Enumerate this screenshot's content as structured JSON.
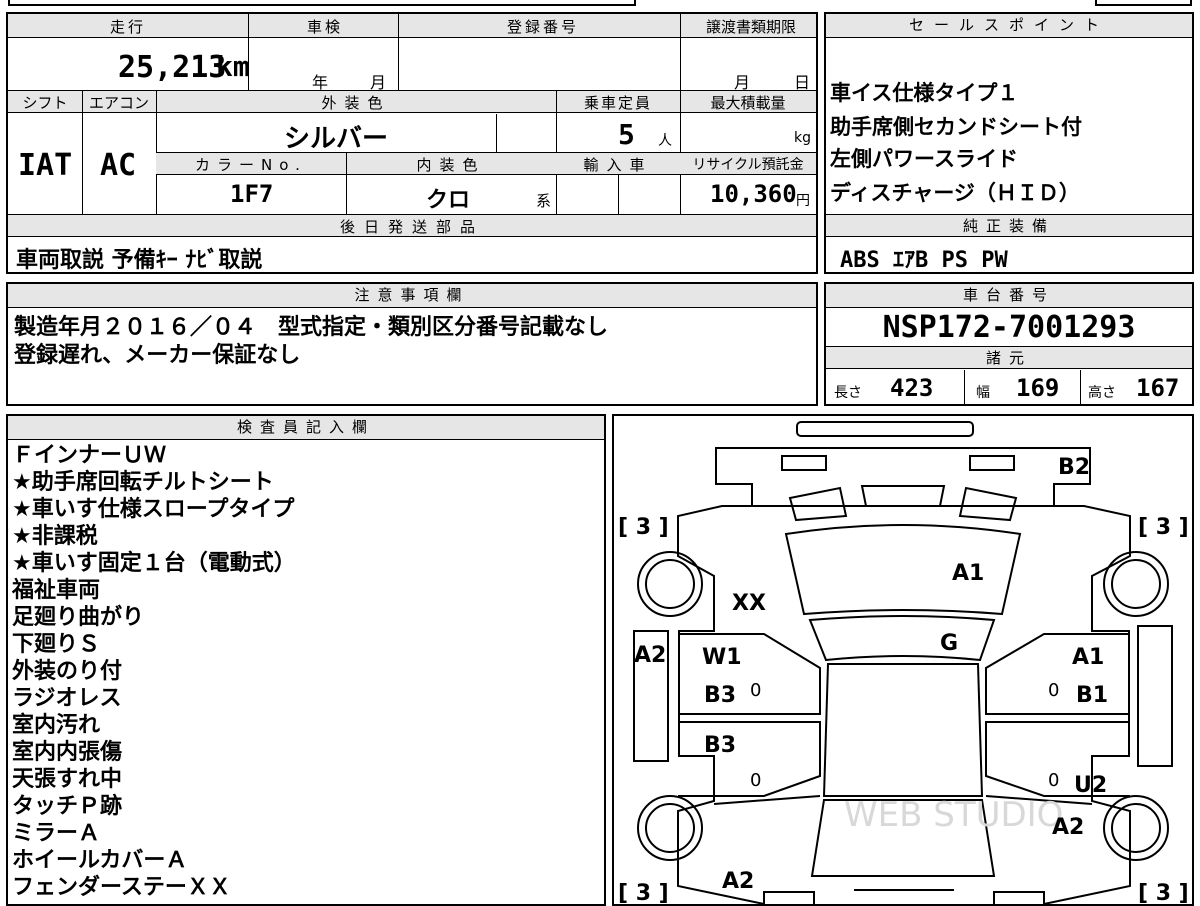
{
  "top_info": {
    "mileage_label": "走行",
    "mileage_value": "25,213",
    "mileage_unit": "km",
    "inspection_label": "車検",
    "inspection_year_unit": "年",
    "inspection_month_unit": "月",
    "registration_label": "登録番号",
    "transfer_deadline_label": "譲渡書類期限",
    "transfer_month_unit": "月",
    "transfer_day_unit": "日",
    "shift_label": "シフト",
    "shift_value": "IAT",
    "ac_label": "エアコン",
    "ac_value": "AC",
    "exterior_color_label": "外装色",
    "exterior_color_value": "シルバー",
    "capacity_label": "乗車定員",
    "capacity_value": "5",
    "capacity_unit": "人",
    "max_load_label": "最大積載量",
    "max_load_unit": "kg",
    "color_no_label": "カラーNo.",
    "color_no_value": "1F7",
    "interior_color_label": "内装色",
    "interior_color_value": "クロ",
    "interior_color_suffix": "系",
    "import_label": "輸入車",
    "recycle_label": "リサイクル預託金",
    "recycle_value": "10,360",
    "recycle_unit": "円",
    "later_parts_label": "後日発送部品",
    "later_parts_value": "車両取説 予備ｷｰ ﾅﾋﾞ取説"
  },
  "sales_points": {
    "label": "セールスポイント",
    "items": [
      "車イス仕様タイプ１",
      "助手席側セカンドシート付",
      "左側パワースライド",
      "ディスチャージ（ＨＩＤ）"
    ]
  },
  "genuine_equipment": {
    "label": "純正装備",
    "value": "ABS ｴｱB PS PW"
  },
  "notes": {
    "label": "注意事項欄",
    "lines": [
      "製造年月２０１６／０４　型式指定・類別区分番号記載なし",
      "登録遅れ、メーカー保証なし"
    ]
  },
  "chassis": {
    "label": "車台番号",
    "value": "NSP172-7001293"
  },
  "specs": {
    "label": "諸元",
    "length_label": "長さ",
    "length_value": "423",
    "width_label": "幅",
    "width_value": "169",
    "height_label": "高さ",
    "height_value": "167"
  },
  "inspector": {
    "label": "検査員記入欄",
    "lines": [
      "ＦインナーＵＷ",
      "★助手席回転チルトシート",
      "★車いす仕様スロープタイプ",
      "★非課税",
      "★車いす固定１台（電動式）",
      "福祉車両",
      "足廻り曲がり",
      "下廻りＳ",
      "外装のり付",
      "ラジオレス",
      "室内汚れ",
      "室内内張傷",
      "天張すれ中",
      "タッチＰ跡",
      "ミラーＡ",
      "ホイールカバーＡ",
      "フェンダーステーＸＸ"
    ]
  },
  "diagram": {
    "marks": {
      "b2": "B2",
      "a1_hood": "A1",
      "xx": "XX",
      "g": "G",
      "a2_left_front": "A2",
      "w1": "W1",
      "b3_front_door": "B3",
      "b3_rear_door": "B3",
      "a1_right": "A1",
      "b1": "B1",
      "u2": "U2",
      "a2_right_rear": "A2",
      "a2_bottom": "A2",
      "zero1": "0",
      "zero2": "0",
      "zero3": "0",
      "zero4": "0"
    },
    "tires": {
      "fl": "[ 3 ]",
      "fr": "[ 3 ]",
      "rl": "[ 3 ]",
      "rr": "[ 3 ]"
    },
    "watermark": "WEB STUDIO"
  }
}
